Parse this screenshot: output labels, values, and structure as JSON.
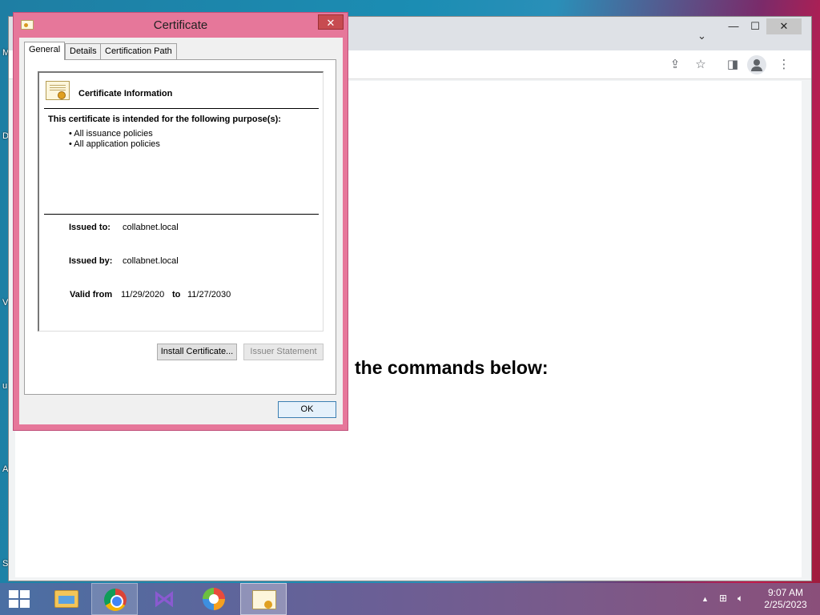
{
  "desktop": {
    "edge_letters": [
      "M",
      "D",
      "V",
      "u",
      "A",
      "S"
    ]
  },
  "browser": {
    "titlebar": {
      "tab_search_icon": "chevron-down-icon",
      "minimize": "—",
      "maximize": "☐",
      "close": "✕"
    },
    "toolbar_icons": [
      "share-icon",
      "star-icon",
      "side-panel-icon",
      "profile-icon",
      "more-icon"
    ],
    "page": {
      "heading": "the commands below:"
    }
  },
  "dialog": {
    "title": "Certificate",
    "close_label": "✕",
    "tabs": [
      {
        "label": "General",
        "active": true
      },
      {
        "label": "Details",
        "active": false
      },
      {
        "label": "Certification Path",
        "active": false
      }
    ],
    "info_title": "Certificate Information",
    "purpose_heading": "This certificate is intended for the following purpose(s):",
    "purposes": [
      "• All issuance policies",
      "• All application policies"
    ],
    "issued_to_label": "Issued to:",
    "issued_to": "collabnet.local",
    "issued_by_label": "Issued by:",
    "issued_by": "collabnet.local",
    "valid_from_label": "Valid from",
    "valid_from": "11/29/2020",
    "to_label": "to",
    "valid_to": "11/27/2030",
    "install_button": "Install Certificate...",
    "issuer_statement_button": "Issuer Statement",
    "ok_button": "OK"
  },
  "taskbar": {
    "apps": [
      "start",
      "file-explorer",
      "chrome",
      "visual-studio",
      "keys-app",
      "certificate"
    ],
    "clock_time": "9:07 AM",
    "clock_date": "2/25/2023",
    "tray_icons": [
      "up-arrow-icon",
      "network-icon",
      "volume-icon"
    ]
  }
}
